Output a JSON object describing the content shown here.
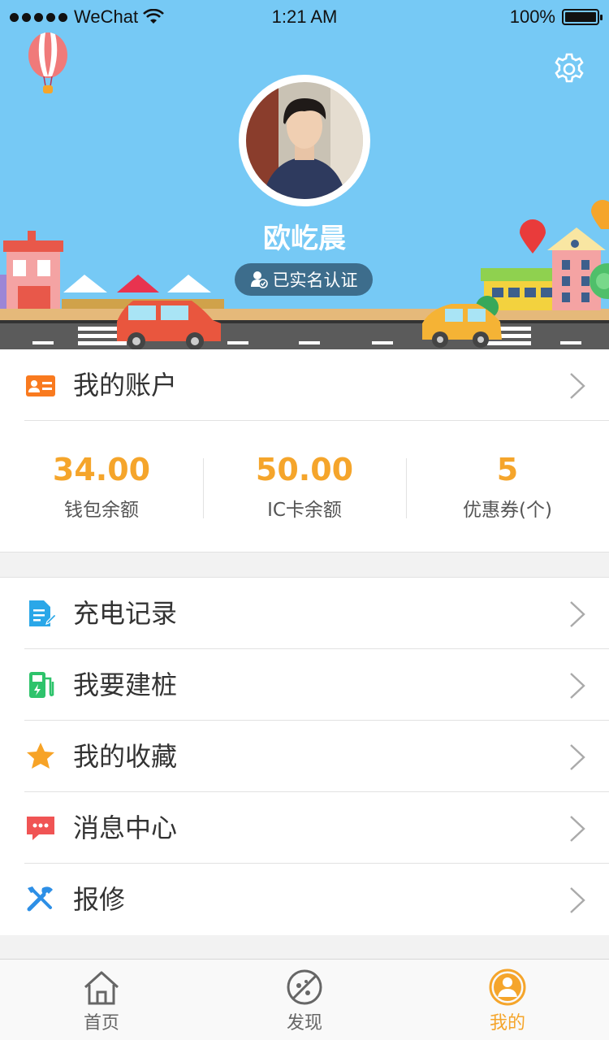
{
  "status_bar": {
    "carrier": "WeChat",
    "time": "1:21 AM",
    "battery": "100%"
  },
  "profile": {
    "name": "欧屹晨",
    "verified_label": "已实名认证"
  },
  "account": {
    "label": "我的账户",
    "stats": [
      {
        "value": "34.00",
        "caption": "钱包余额"
      },
      {
        "value": "50.00",
        "caption": "IC卡余额"
      },
      {
        "value": "5",
        "caption": "优惠券(个)"
      }
    ]
  },
  "menu": [
    {
      "label": "充电记录",
      "icon": "document-edit-icon"
    },
    {
      "label": "我要建桩",
      "icon": "charging-station-icon"
    },
    {
      "label": "我的收藏",
      "icon": "star-icon"
    },
    {
      "label": "消息中心",
      "icon": "message-icon"
    },
    {
      "label": "报修",
      "icon": "tools-icon"
    }
  ],
  "tabbar": {
    "active": "我的",
    "items": [
      {
        "label": "首页",
        "icon": "home-icon"
      },
      {
        "label": "发现",
        "icon": "discover-icon"
      },
      {
        "label": "我的",
        "icon": "profile-icon"
      }
    ]
  },
  "colors": {
    "header_bg": "#76c9f5",
    "accent": "#f5a52b",
    "verify_badge": "#3d6d8c"
  }
}
